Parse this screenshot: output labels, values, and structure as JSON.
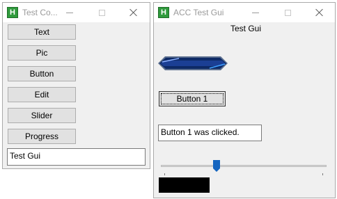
{
  "control_window": {
    "title": "Test Co...",
    "app_icon_letter": "H",
    "buttons": [
      "Text",
      "Pic",
      "Button",
      "Edit",
      "Slider",
      "Progress"
    ],
    "edit_value": "Test Gui"
  },
  "gui_window": {
    "title": "ACC Test Gui",
    "app_icon_letter": "H",
    "text_label": "Test Gui",
    "button1_label": "Button 1",
    "status_text": "Button 1 was clicked.",
    "slider_value": 0.33,
    "slider_color": "#1565c0",
    "progress_color": "#000000"
  }
}
